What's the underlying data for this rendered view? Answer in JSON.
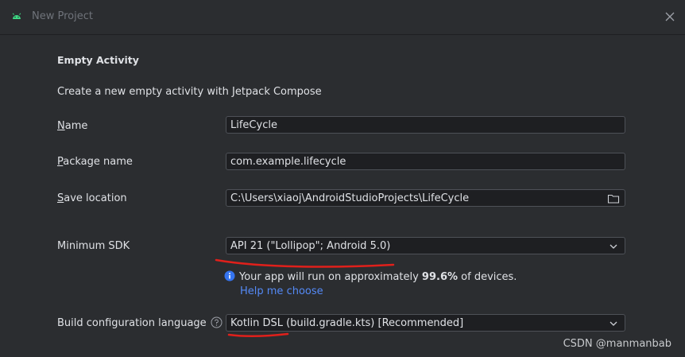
{
  "window": {
    "title": "New Project"
  },
  "template": {
    "heading": "Empty Activity",
    "description": "Create a new empty activity with Jetpack Compose"
  },
  "form": {
    "name": {
      "mnemonic": "N",
      "label_rest": "ame",
      "value": "LifeCycle"
    },
    "package": {
      "mnemonic": "P",
      "label_rest": "ackage name",
      "value": "com.example.lifecycle"
    },
    "save_location": {
      "mnemonic": "S",
      "label_rest": "ave location",
      "value": "C:\\Users\\xiaoj\\AndroidStudioProjects\\LifeCycle"
    },
    "min_sdk": {
      "label": "Minimum SDK",
      "value": "API 21 (\"Lollipop\"; Android 5.0)"
    },
    "info": {
      "prefix": "Your app will run on approximately ",
      "percent": "99.6%",
      "suffix": " of devices."
    },
    "help_link": "Help me choose",
    "build_lang": {
      "label": "Build configuration language",
      "value": "Kotlin DSL (build.gradle.kts) [Recommended]"
    }
  },
  "watermark": "CSDN @manmanbab",
  "colors": {
    "background": "#2b2d30",
    "field_bg": "#1e1f22",
    "field_border": "#4e5157",
    "text": "#dfe1e5",
    "link": "#548af7",
    "info_blue": "#3574f0",
    "annotation_red": "#e0201b"
  },
  "icons": [
    "android-icon",
    "close-icon",
    "folder-icon",
    "chevron-down-icon",
    "info-icon",
    "help-icon"
  ]
}
